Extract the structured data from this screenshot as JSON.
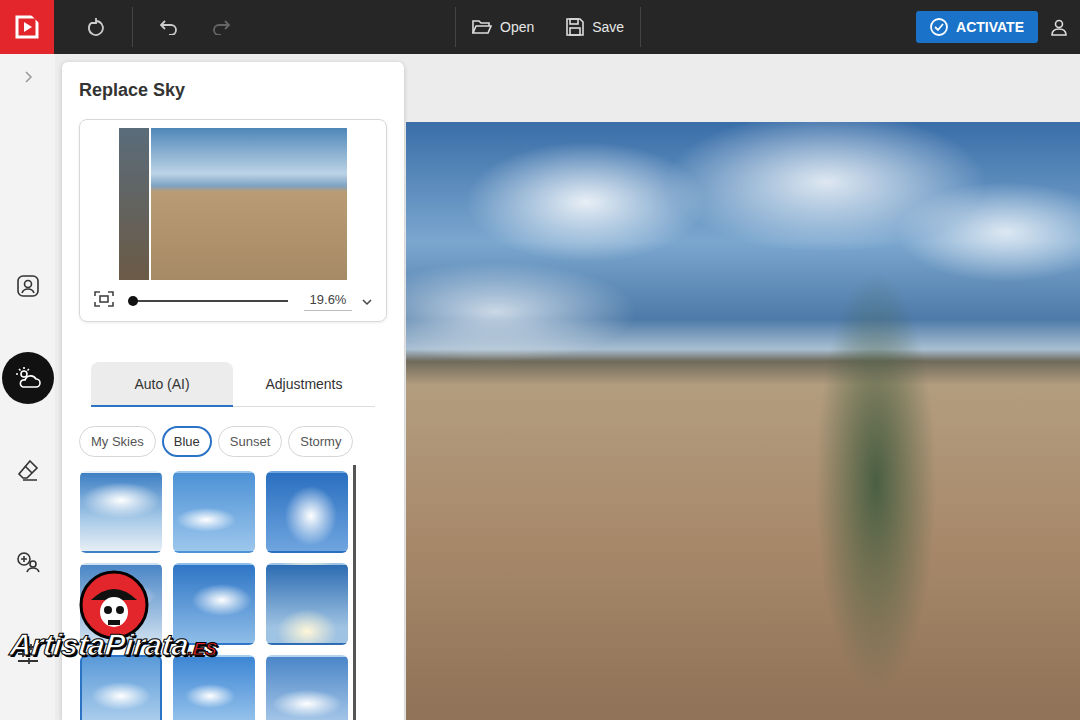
{
  "toolbar": {
    "undo": {
      "disabled": false
    },
    "redo": {
      "disabled": true
    },
    "buttons": [
      {
        "label": "Open",
        "kind": "open"
      },
      {
        "label": "Save",
        "kind": "save"
      }
    ],
    "activate": {
      "label": "ACTIVATE"
    }
  },
  "rail": {
    "items": [
      {
        "kind": "portrait",
        "selected": false
      },
      {
        "kind": "sky",
        "selected": true
      },
      {
        "kind": "eraser",
        "selected": false
      },
      {
        "kind": "replace",
        "selected": false
      },
      {
        "kind": "sliders",
        "selected": false
      }
    ]
  },
  "panel": {
    "title": "Replace Sky",
    "preview": {
      "zoom": "19.6%",
      "level": 0.02
    }
  },
  "tabs": [
    {
      "label": "Auto (AI)",
      "selected": true
    },
    {
      "label": "Adjustments",
      "selected": false
    }
  ],
  "categories": [
    {
      "label": "My Skies",
      "selected": false
    },
    {
      "label": "Blue",
      "selected": true
    },
    {
      "label": "Sunset",
      "selected": false
    },
    {
      "label": "Stormy",
      "selected": false
    }
  ],
  "thumbnails": [
    {
      "selected": false
    },
    {
      "selected": false
    },
    {
      "selected": false
    },
    {
      "selected": false
    },
    {
      "selected": false
    },
    {
      "selected": false
    },
    {
      "selected": true
    },
    {
      "selected": false
    },
    {
      "selected": false
    }
  ],
  "watermark": {
    "text": "ArtistaPirata",
    "suffix": ".ES"
  }
}
